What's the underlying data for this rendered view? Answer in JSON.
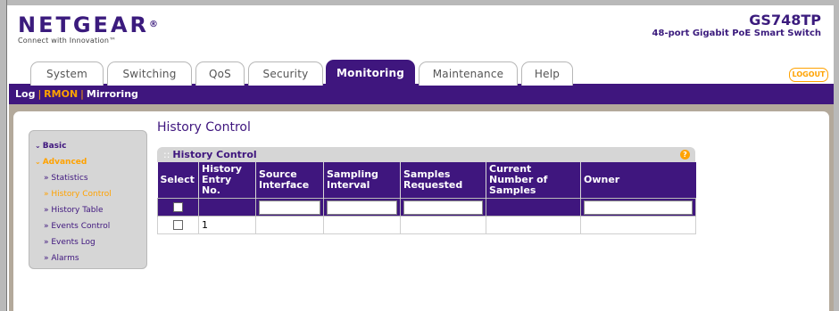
{
  "brand": {
    "logo": "NETGEAR",
    "logo_mark": "®",
    "tagline": "Connect with Innovation™"
  },
  "model": {
    "name": "GS748TP",
    "description": "48-port Gigabit PoE Smart Switch"
  },
  "tabs": [
    {
      "label": "System"
    },
    {
      "label": "Switching"
    },
    {
      "label": "QoS"
    },
    {
      "label": "Security"
    },
    {
      "label": "Monitoring",
      "active": true
    },
    {
      "label": "Maintenance"
    },
    {
      "label": "Help"
    }
  ],
  "logout_label": "LOGOUT",
  "subnav": {
    "log": "Log",
    "rmon": "RMON",
    "mirroring": "Mirroring",
    "separator": "|"
  },
  "leftnav": {
    "basic": "Basic",
    "advanced": "Advanced",
    "items": [
      {
        "label": "» Statistics"
      },
      {
        "label": "» History Control",
        "selected": true
      },
      {
        "label": "» History Table"
      },
      {
        "label": "» Events Control"
      },
      {
        "label": "» Events Log"
      },
      {
        "label": "» Alarms"
      }
    ]
  },
  "page_title": "History Control",
  "panel": {
    "title": "History Control",
    "title_prefix": "::",
    "help_icon": "?",
    "columns": [
      "Select",
      "History Entry No.",
      "Source Interface",
      "Sampling Interval",
      "Samples Requested",
      "Current Number of Samples",
      "Owner"
    ],
    "filter_row": {
      "source_interface": "",
      "sampling_interval": "",
      "samples_requested": "",
      "owner": ""
    },
    "rows": [
      {
        "history_entry_no": "1",
        "source_interface": "",
        "sampling_interval": "",
        "samples_requested": "",
        "current_number_of_samples": "",
        "owner": ""
      }
    ]
  },
  "colors": {
    "brand_purple": "#3f167e",
    "accent_orange": "#ffa200",
    "frame_grey": "#b3a99b"
  }
}
